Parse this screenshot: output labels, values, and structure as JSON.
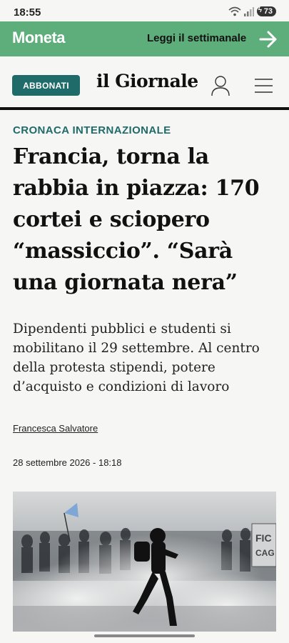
{
  "status_bar": {
    "time": "18:55",
    "battery": "73"
  },
  "promo": {
    "logo": "Moneta",
    "cta": "Leggi il settimanale"
  },
  "header": {
    "subscribe_label": "ABBONATI",
    "brand": "il Giornale"
  },
  "article": {
    "kicker": "CRONACA INTERNAZIONALE",
    "headline": "Francia, torna la rabbia in piazza: 170 cortei e sciopero “massiccio”. “Sarà una giornata nera”",
    "standfirst": "Dipendenti pubblici e studenti si mobilitano il 29 settembre. Al centro della protesta stipendi, potere d’acquisto e condizioni di lavoro",
    "author": "Francesca Salvatore",
    "date": "28 settembre 2026 - 18:18"
  },
  "colors": {
    "promo_bg": "#5eae7c",
    "accent": "#1f6b6a"
  }
}
